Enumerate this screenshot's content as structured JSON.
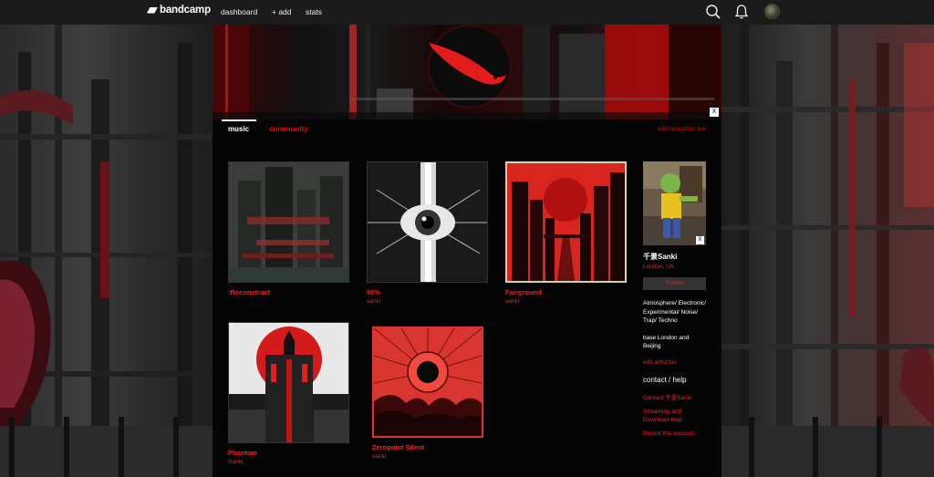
{
  "topbar": {
    "brand": "bandcamp",
    "nav": [
      "dashboard",
      "+ add",
      "stats"
    ]
  },
  "tabs": {
    "music": "music",
    "community": "community",
    "edit_nav": "edit navigation bar"
  },
  "ad_close": "X",
  "albums": [
    {
      "title": ":Reconstruct",
      "artist": ""
    },
    {
      "title": "88%",
      "artist": "sanki"
    },
    {
      "title": "Fairground",
      "artist": "sanki"
    },
    {
      "title": "Phantom",
      "artist": "Sanki"
    },
    {
      "title": "Zeropoint Silent",
      "artist": "sanki"
    }
  ],
  "sidebar": {
    "photo_close": "X",
    "artist_name": "千景Sanki",
    "location": "London, UK",
    "follow": "Follow",
    "bio_genres": "Atmosphere/ Electronic/ Experimental/ Noise/ Trap/ Techno",
    "bio_base": "base London and Beijing",
    "edit_bio": "edit artist bio",
    "contact_heading": "contact / help",
    "links": [
      "Contact 千景Sanki",
      "Streaming and Download help",
      "Report this account"
    ]
  },
  "colors": {
    "accent": "#e02020",
    "topbar": "#1b1b1b",
    "page": "#050505"
  }
}
